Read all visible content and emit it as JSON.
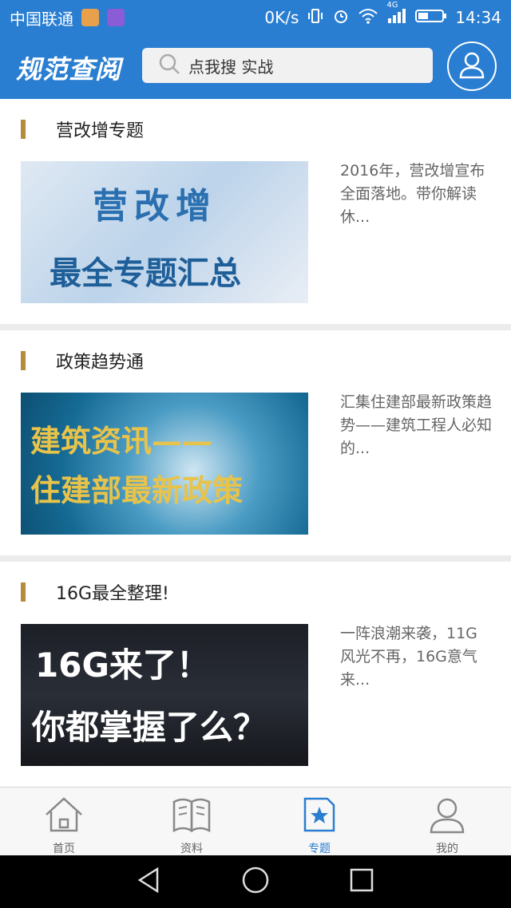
{
  "status": {
    "carrier": "中国联通",
    "speed": "0K/s",
    "network": "4G",
    "time": "14:34"
  },
  "header": {
    "logo": "规范查阅",
    "search_placeholder": "点我搜 实战"
  },
  "cards": [
    {
      "title": "营改增专题",
      "thumb_line1": "营改增",
      "thumb_line2": "最全专题汇总",
      "desc": "2016年，营改增宣布全面落地。带你解读休..."
    },
    {
      "title": "政策趋势通",
      "thumb_line1": "建筑资讯——",
      "thumb_line2": "住建部最新政策",
      "desc": "汇集住建部最新政策趋势——建筑工程人必知的..."
    },
    {
      "title": "16G最全整理!",
      "thumb_line1": "16G来了！",
      "thumb_line2": "你都掌握了么？",
      "desc": "一阵浪潮来袭，11G风光不再，16G意气来..."
    }
  ],
  "tabs": [
    {
      "label": "首页",
      "icon": "home-icon"
    },
    {
      "label": "资料",
      "icon": "book-icon"
    },
    {
      "label": "专题",
      "icon": "star-doc-icon",
      "active": true
    },
    {
      "label": "我的",
      "icon": "user-icon"
    }
  ],
  "colors": {
    "primary": "#2a7ed1",
    "accent_bar": "#b58b3c"
  }
}
